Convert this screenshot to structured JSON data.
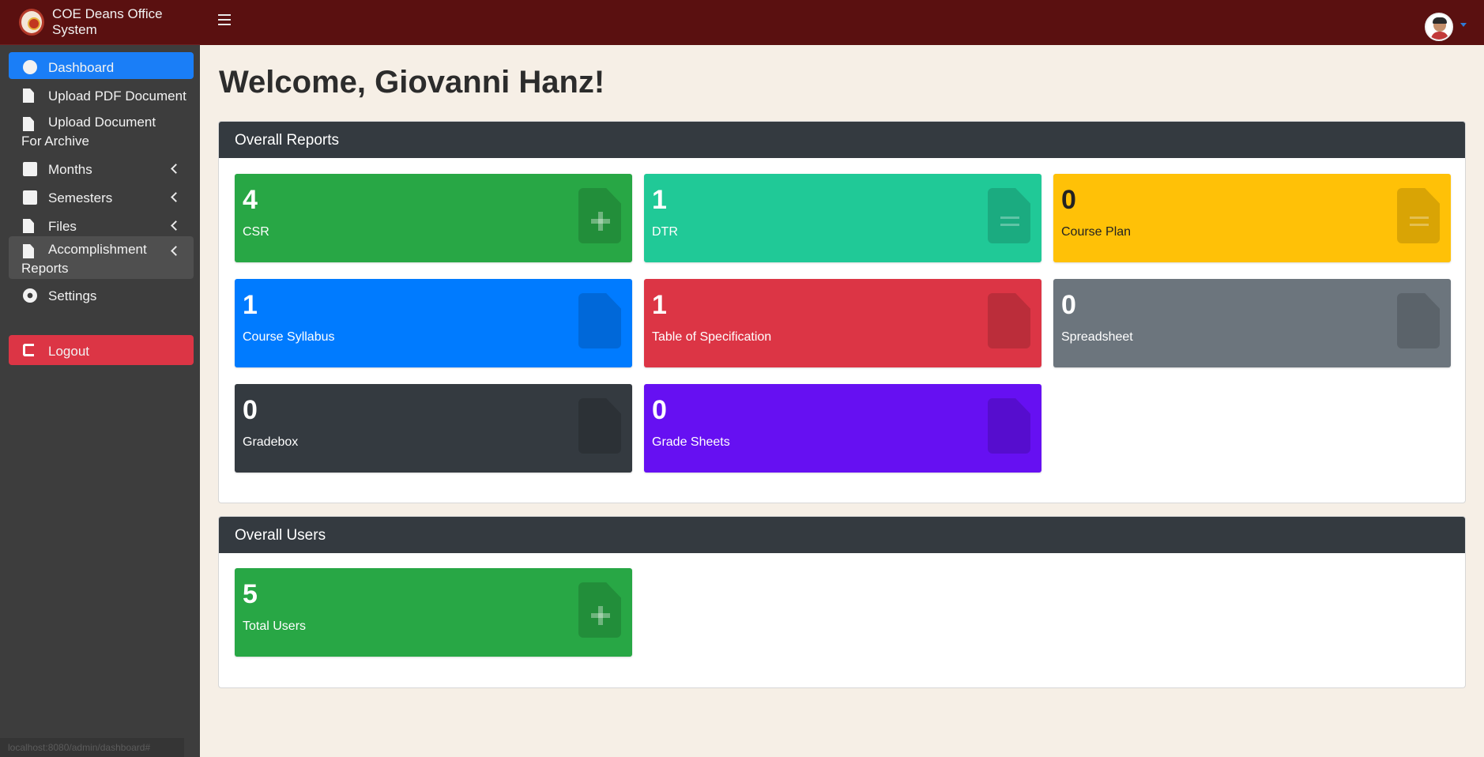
{
  "app": {
    "title": "COE Deans Office System",
    "status_url": "localhost:8080/admin/dashboard#"
  },
  "colors": {
    "navbar": "#5a1010",
    "sidebar": "#3d3d3d",
    "active": "#1a7ef7",
    "logout": "#dc3545"
  },
  "sidebar": {
    "items": [
      {
        "label": "Dashboard",
        "icon": "dashboard-icon"
      },
      {
        "label": "Upload PDF Document",
        "icon": "file-icon"
      },
      {
        "label": "Upload Document For Archive",
        "icon": "file-icon"
      },
      {
        "label": "Months",
        "icon": "calendar-icon"
      },
      {
        "label": "Semesters",
        "icon": "calendar-icon"
      },
      {
        "label": "Files",
        "icon": "file-icon"
      },
      {
        "label": "Accomplishment Reports",
        "icon": "file-icon"
      },
      {
        "label": "Settings",
        "icon": "gears-icon"
      },
      {
        "label": "Logout",
        "icon": "sign-out-icon"
      }
    ]
  },
  "main": {
    "welcome": "Welcome, Giovanni Hanz!",
    "reports_title": "Overall Reports",
    "reports": [
      {
        "value": "4",
        "label": "CSR",
        "color": "#28a745",
        "icon": "file-medical-icon"
      },
      {
        "value": "1",
        "label": "DTR",
        "color": "#20c997",
        "icon": "file-invoice-icon"
      },
      {
        "value": "0",
        "label": "Course Plan",
        "color": "#ffc107",
        "icon": "file-alt-icon"
      },
      {
        "value": "1",
        "label": "Course Syllabus",
        "color": "#007bff",
        "icon": "file-signature-icon"
      },
      {
        "value": "1",
        "label": "Table of Specification",
        "color": "#dc3545",
        "icon": "file-contract-icon"
      },
      {
        "value": "0",
        "label": "Spreadsheet",
        "color": "#6c757d",
        "icon": "file-excel-icon"
      },
      {
        "value": "0",
        "label": "Gradebox",
        "color": "#343a40",
        "icon": "file-archive-icon"
      },
      {
        "value": "0",
        "label": "Grade Sheets",
        "color": "#6610f2",
        "icon": "file-icon"
      }
    ],
    "users_title": "Overall Users",
    "users": [
      {
        "value": "5",
        "label": "Total Users",
        "color": "#28a745",
        "icon": "file-medical-icon"
      }
    ]
  }
}
